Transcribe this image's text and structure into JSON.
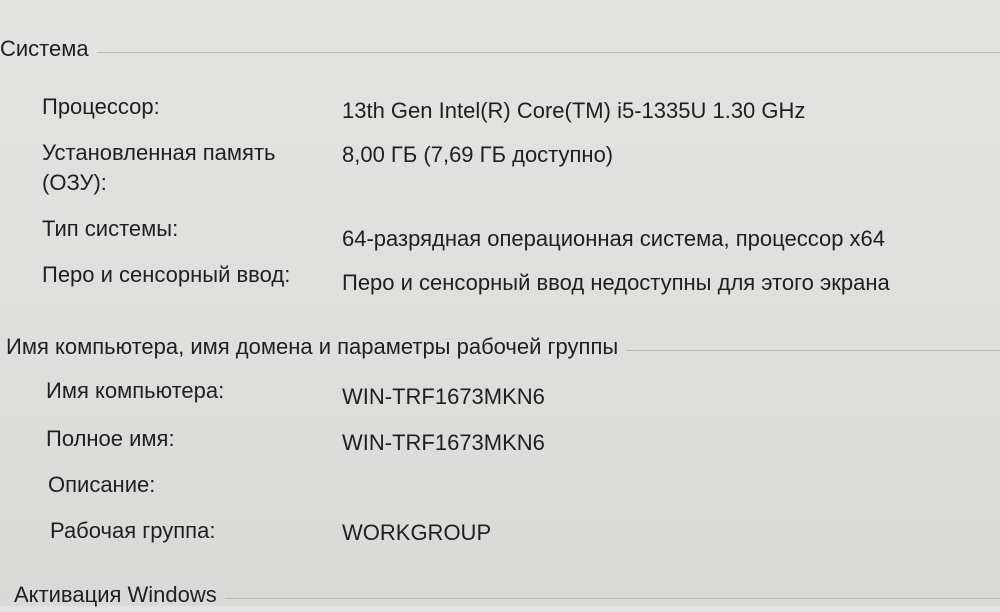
{
  "system": {
    "title": "Система",
    "rows": [
      {
        "label": "Процессор:",
        "value": "13th Gen Intel(R) Core(TM) i5-1335U   1.30 GHz"
      },
      {
        "label_line1": "Установленная память",
        "label_line2": "(ОЗУ):",
        "value": "8,00 ГБ (7,69 ГБ доступно)"
      },
      {
        "label": "Тип системы:",
        "value": "64-разрядная операционная система, процессор x64"
      },
      {
        "label": "Перо и сенсорный ввод:",
        "value": "Перо и сенсорный ввод недоступны для этого экрана"
      }
    ]
  },
  "computer_name": {
    "title": "Имя компьютера, имя домена и параметры рабочей группы",
    "rows": [
      {
        "label": "Имя компьютера:",
        "value": "WIN-TRF1673MKN6"
      },
      {
        "label": "Полное имя:",
        "value": "WIN-TRF1673MKN6"
      },
      {
        "label": "Описание:",
        "value": ""
      },
      {
        "label": "Рабочая группа:",
        "value": "WORKGROUP"
      }
    ]
  },
  "activation": {
    "title": "Активация Windows"
  }
}
